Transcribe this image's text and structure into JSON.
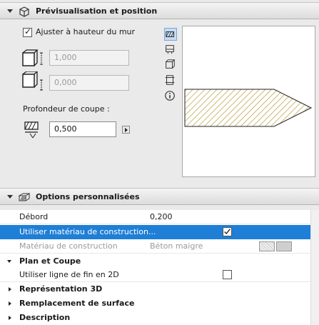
{
  "preview_section": {
    "title": "Prévisualisation et position",
    "icon": "preview-settings-icon",
    "fit_to_wall_label": "Ajuster à hauteur du mur",
    "fit_to_wall_checked": true,
    "height_top_value": "1,000",
    "height_bottom_value": "0,000",
    "cut_depth_label": "Profondeur de coupe :",
    "cut_depth_value": "0,500",
    "view_icons": [
      "section-view-icon",
      "plan-view-icon",
      "3d-view-icon",
      "elevation-view-icon",
      "info-icon"
    ]
  },
  "custom_section": {
    "title": "Options personnalisées",
    "icon": "custom-options-icon",
    "rows": [
      {
        "label": "Débord",
        "value": "0,200"
      },
      {
        "label": "Utiliser matériau de construction...",
        "checked": true,
        "selected": true
      },
      {
        "label": "Matériau de construction",
        "value": "Béton maigre",
        "disabled": true
      },
      {
        "label": "Plan et Coupe",
        "group": true,
        "expanded": true
      },
      {
        "label": "Utiliser ligne de fin en 2D",
        "checked": false
      },
      {
        "label": "Représentation 3D",
        "group": true,
        "expanded": false
      },
      {
        "label": "Remplacement de surface",
        "group": true,
        "expanded": false
      },
      {
        "label": "Description",
        "group": true,
        "expanded": false
      }
    ]
  },
  "colors": {
    "selection": "#1f7fd6",
    "hatch": "#b8962e"
  }
}
